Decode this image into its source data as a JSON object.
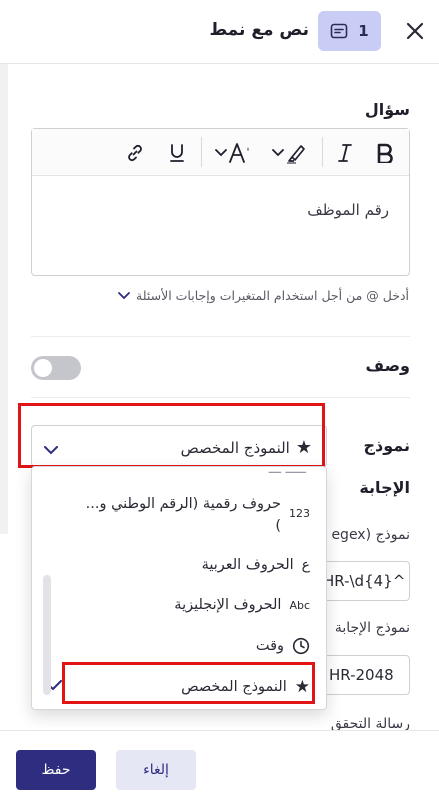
{
  "header": {
    "title": "نص مع نمط",
    "badge_number": "1",
    "badge_icon": "text-box-icon",
    "close_icon": "close-icon"
  },
  "question": {
    "label": "سؤال",
    "editor_value": "رقم الموظف",
    "toolbar": [
      "bold",
      "italic",
      "highlight",
      "text-color",
      "underline",
      "link"
    ],
    "hint": "أدخل @ من أجل استخدام المتغيرات وإجابات الأسئلة"
  },
  "description": {
    "label": "وصف",
    "enabled": false
  },
  "template": {
    "label": "نموذج",
    "selected": "النموذج المخصص",
    "options": [
      {
        "label": "حروف رقمية (الرقم الوطني و...",
        "label_line2": ")",
        "icon": "123"
      },
      {
        "label": "الحروف العربية",
        "icon": "ع"
      },
      {
        "label": "الحروف الإنجليزية",
        "icon": "Abc"
      },
      {
        "label": "وقت",
        "icon": "clock-icon"
      },
      {
        "label": "النموذج المخصص",
        "icon": "star-icon",
        "checked": true
      }
    ]
  },
  "answer": {
    "label": "الإجابة",
    "regex_label": "نموذج (egex",
    "regex_value": "HR-\\d{4}^",
    "example_label": "نموذج الإجابة",
    "example_value": "HR-2048",
    "validation_label": "رسالة التحقق"
  },
  "footer": {
    "save_label": "حفظ",
    "cancel_label": "إلغاء"
  },
  "colors": {
    "primary": "#2e2d7f",
    "badge_bg": "#c9cdf5",
    "highlight_border": "#e01414"
  }
}
